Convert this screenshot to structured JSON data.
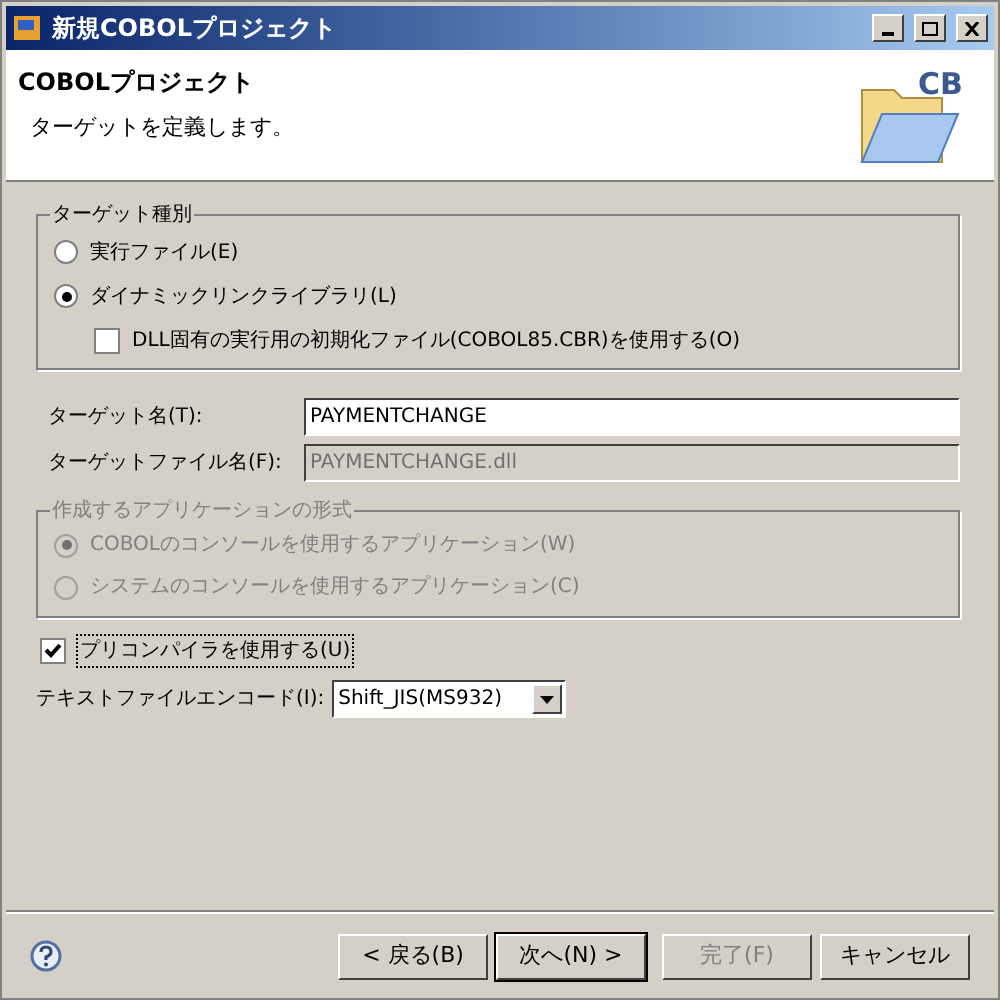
{
  "window": {
    "title": "新規COBOLプロジェクト"
  },
  "header": {
    "title": "COBOLプロジェクト",
    "description": "ターゲットを定義します。",
    "logo_text": "CB"
  },
  "target_type": {
    "label": "ターゲット種別",
    "options": [
      {
        "label": "実行ファイル(E)",
        "selected": false
      },
      {
        "label": "ダイナミックリンクライブラリ(L)",
        "selected": true
      }
    ],
    "dll_init": {
      "label": "DLL固有の実行用の初期化ファイル(COBOL85.CBR)を使用する(O)",
      "checked": false
    }
  },
  "fields": [
    {
      "label": "ターゲット名(T):",
      "value": "PAYMENTCHANGE",
      "disabled": false
    },
    {
      "label": "ターゲットファイル名(F):",
      "value": "PAYMENTCHANGE.dll",
      "disabled": true
    }
  ],
  "app_format": {
    "label": "作成するアプリケーションの形式",
    "disabled": true,
    "options": [
      {
        "label": "COBOLのコンソールを使用するアプリケーション(W)",
        "selected": true
      },
      {
        "label": "システムのコンソールを使用するアプリケーション(C)",
        "selected": false
      }
    ]
  },
  "precompiler": {
    "label": "プリコンパイラを使用する(U)",
    "checked": true
  },
  "encoding": {
    "label": "テキストファイルエンコード(I):",
    "value": "Shift_JIS(MS932)"
  },
  "buttons": [
    {
      "label": "< 戻る(B)",
      "disabled": false,
      "default": false
    },
    {
      "label": "次へ(N) >",
      "disabled": false,
      "default": true
    },
    {
      "label": "完了(F)",
      "disabled": true,
      "default": false
    },
    {
      "label": "キャンセル",
      "disabled": false,
      "default": false
    }
  ]
}
